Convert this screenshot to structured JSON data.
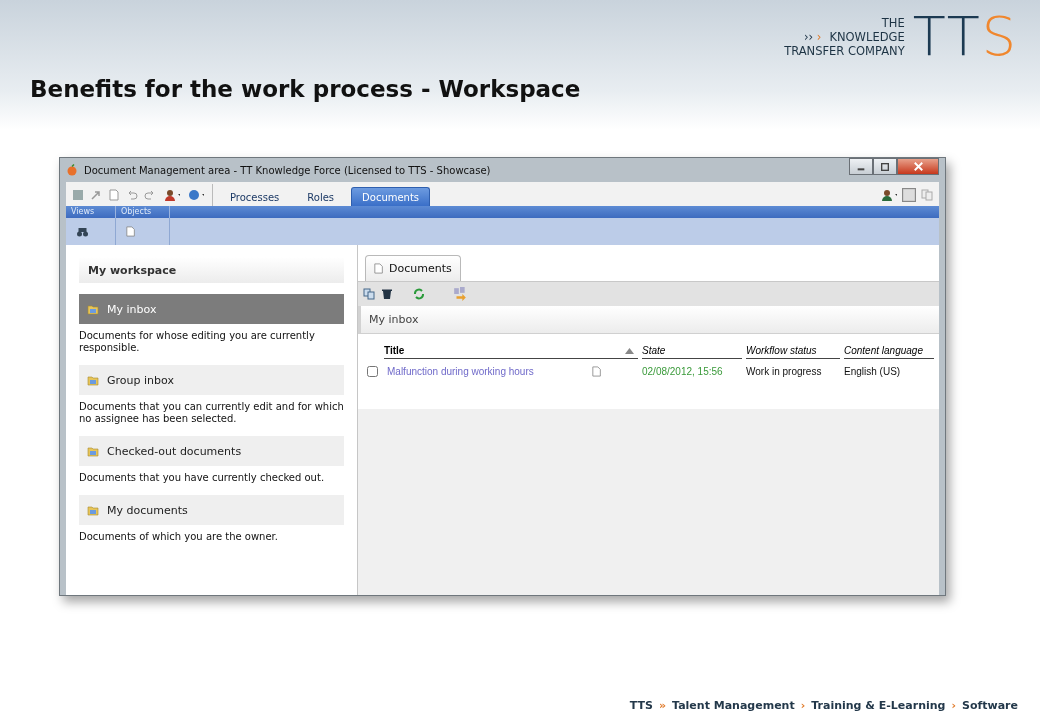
{
  "slide": {
    "title": "Benefits for the work process - Workspace",
    "logo": {
      "line_1": "THE",
      "marks_grey": "››",
      "marks_orange": "›",
      "line_2": "KNOWLEDGE",
      "line_3": "TRANSFER COMPANY",
      "wordmark_dark": "TT",
      "wordmark_orange": "S"
    },
    "footer": [
      {
        "kind": "brand",
        "text": "TTS"
      },
      {
        "kind": "sep",
        "text": "»"
      },
      {
        "kind": "item",
        "text": "Talent Management"
      },
      {
        "kind": "sep",
        "text": "›"
      },
      {
        "kind": "item",
        "text": "Training & E-Learning"
      },
      {
        "kind": "sep",
        "text": "›"
      },
      {
        "kind": "item",
        "text": "Software"
      }
    ]
  },
  "window": {
    "title": "Document Management area - TT Knowledge Force (Licensed to TTS - Showcase)",
    "tabs": [
      {
        "label": "Processes",
        "selected": false
      },
      {
        "label": "Roles",
        "selected": false
      },
      {
        "label": "Documents",
        "selected": true
      }
    ],
    "ribbon_groups": [
      {
        "label": "Views"
      },
      {
        "label": "Objects"
      }
    ],
    "sidebar": {
      "heading": "My workspace",
      "items": [
        {
          "label": "My inbox",
          "description": "Documents for whose editing you are currently responsible.",
          "selected": true
        },
        {
          "label": "Group inbox",
          "description": "Documents that you can currently edit and for which no assignee has been selected.",
          "selected": false
        },
        {
          "label": "Checked-out documents",
          "description": "Documents that you have currently checked out.",
          "selected": false
        },
        {
          "label": "My documents",
          "description": "Documents of which you are the owner.",
          "selected": false
        }
      ]
    },
    "content": {
      "tab": {
        "label": "Documents",
        "selected": true
      },
      "section_title": "My inbox",
      "table": {
        "columns": [
          {
            "label": "Title",
            "sorted": true
          },
          {
            "label": "State",
            "sorted": false
          },
          {
            "label": "Workflow status",
            "sorted": false
          },
          {
            "label": "Content language",
            "sorted": false
          }
        ],
        "rows": [
          {
            "checked": false,
            "title": "Malfunction during working hours",
            "state": "02/08/2012, 15:56",
            "workflow_status": "Work in progress",
            "content_language": "English (US)"
          }
        ]
      }
    }
  }
}
